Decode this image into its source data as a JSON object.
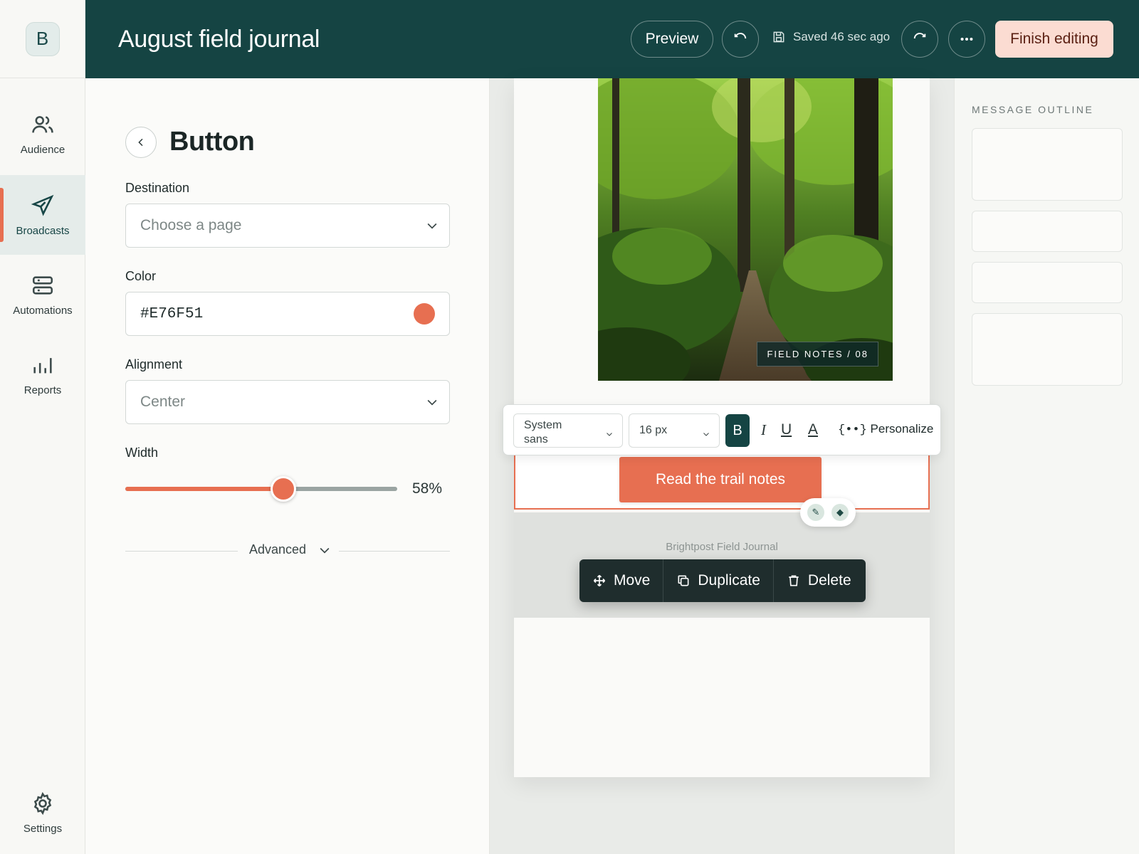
{
  "app": {
    "logo_letter": "B",
    "document_title": "August field journal"
  },
  "nav": {
    "items": [
      {
        "label": "Audience",
        "icon": "users-icon"
      },
      {
        "label": "Broadcasts",
        "icon": "send-icon",
        "active": true
      },
      {
        "label": "Automations",
        "icon": "automations-icon"
      },
      {
        "label": "Reports",
        "icon": "bar-chart-icon"
      },
      {
        "label": "Settings",
        "icon": "gear-icon"
      }
    ]
  },
  "header": {
    "preview_label": "Preview",
    "saved_status": "Saved 46 sec ago",
    "finish_label": "Finish editing"
  },
  "panel": {
    "title": "Button",
    "destination": {
      "label": "Destination",
      "placeholder": "Choose a page"
    },
    "color": {
      "label": "Color",
      "value": "#E76F51"
    },
    "alignment": {
      "label": "Alignment",
      "value": "Center"
    },
    "width": {
      "label": "Width",
      "value_text": "58%",
      "fraction": 0.58
    },
    "advanced_label": "Advanced"
  },
  "canvas": {
    "hero_badge": "FIELD NOTES / 08",
    "cta_label": "Read the trail notes",
    "footer_text": "Brightpost Field Journal",
    "text_toolbar": {
      "font_line1": "System",
      "font_line2": "sans",
      "size": "16 px",
      "bold": "B",
      "italic": "I",
      "underline": "U",
      "color": "A",
      "personalize_token": "{••}",
      "personalize": "Personalize"
    },
    "block_actions": {
      "move": "Move",
      "duplicate": "Duplicate",
      "delete": "Delete"
    }
  },
  "outline": {
    "title": "MESSAGE OUTLINE"
  },
  "colors": {
    "brand": "#154443",
    "accent": "#E76F51",
    "finish_bg": "#FBDCD2"
  }
}
